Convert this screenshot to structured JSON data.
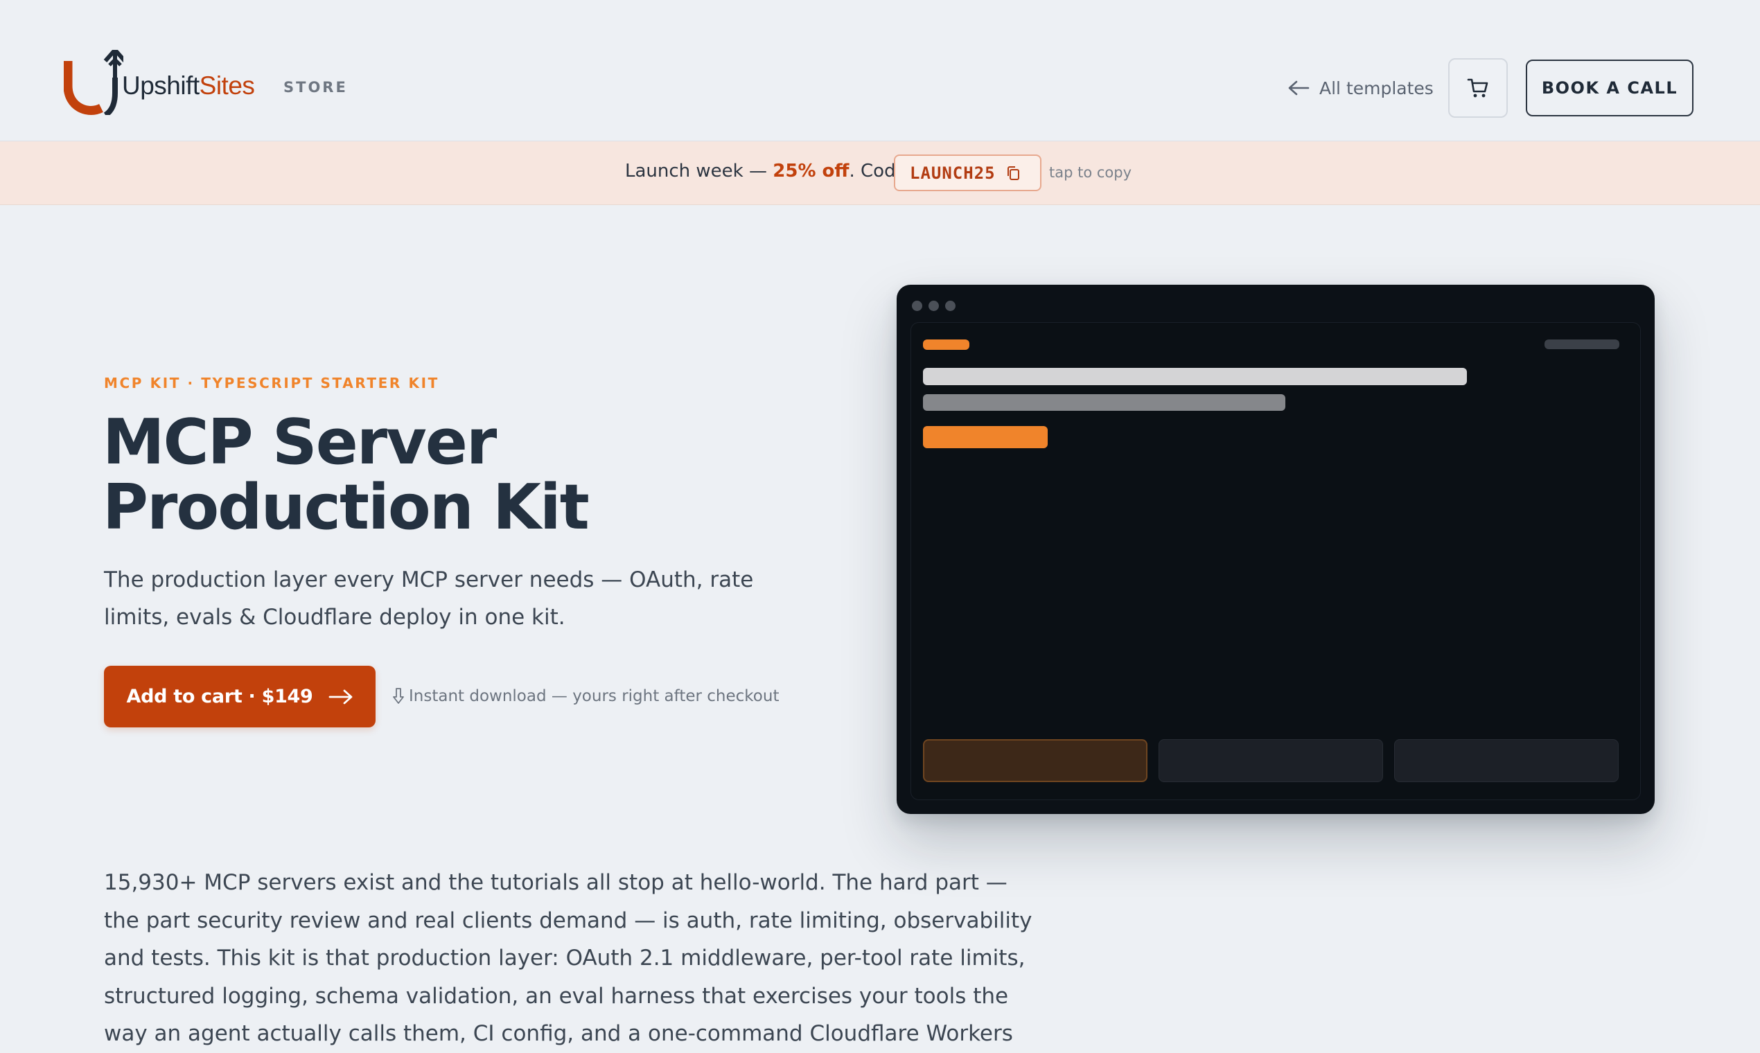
{
  "header": {
    "brand_part1": "Upshift",
    "brand_part2": "Sites",
    "store_label": "STORE",
    "all_templates_label": "All templates",
    "book_call_label": "BOOK A CALL",
    "logo_icon": "upshift-logo-icon",
    "cart_icon": "cart-icon",
    "back_icon": "arrow-left-icon"
  },
  "promo": {
    "text_prefix": "Launch week — ",
    "discount": "25% off",
    "text_suffix": ". Code",
    "code": "LAUNCH25",
    "copy_icon": "copy-icon",
    "hint": "tap to copy"
  },
  "hero": {
    "eyebrow": "MCP KIT · TYPESCRIPT STARTER KIT",
    "title_line1": "MCP Server",
    "title_line2": "Production Kit",
    "subtitle": "The production layer every MCP server needs — OAuth, rate limits, evals & Cloudflare deploy in one kit.",
    "cta_label": "Add to cart · $149",
    "cta_icon": "arrow-right-icon",
    "download_icon": "download-arrow-icon",
    "download_note": "Instant download — yours right after checkout"
  },
  "body": {
    "paragraph": "15,930+ MCP servers exist and the tutorials all stop at hello-world. The hard part — the part security review and real clients demand — is auth, rate limiting, observability and tests. This kit is that production layer: OAuth 2.1 middleware, per-tool rate limits, structured logging, schema validation, an eval harness that exercises your tools the way an agent actually calls them, CI config, and a one-command Cloudflare Workers"
  },
  "colors": {
    "accent": "#c2410c",
    "eyebrow": "#f0842b",
    "heading": "#243140",
    "page_bg": "#edf0f4",
    "promo_bg": "#f7e6df",
    "preview_bg": "#0c1117"
  }
}
